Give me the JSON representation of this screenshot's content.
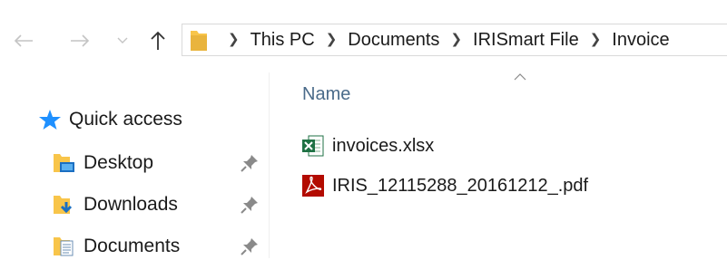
{
  "nav": {
    "back_icon": "arrow-left-icon",
    "forward_icon": "arrow-right-icon",
    "recent_icon": "chevron-down-icon",
    "up_icon": "arrow-up-icon"
  },
  "address_bar": {
    "root_icon": "folder-icon",
    "breadcrumbs": [
      "This PC",
      "Documents",
      "IRISmart File",
      "Invoice"
    ]
  },
  "sidebar": {
    "items": [
      {
        "label": "Quick access",
        "icon": "star-icon"
      },
      {
        "label": "Desktop",
        "icon": "desktop-folder-icon",
        "pinned": true
      },
      {
        "label": "Downloads",
        "icon": "downloads-folder-icon",
        "pinned": true
      },
      {
        "label": "Documents",
        "icon": "documents-folder-icon",
        "pinned": true
      }
    ]
  },
  "file_list": {
    "column_header": "Name",
    "sort_icon": "caret-up-icon",
    "files": [
      {
        "name": "invoices.xlsx",
        "icon": "excel-file-icon"
      },
      {
        "name": "IRIS_12115288_20161212_.pdf",
        "icon": "pdf-file-icon"
      }
    ]
  },
  "colors": {
    "address_border": "#d9d9d9",
    "column_header": "#4a6b8a",
    "quick_access_star": "#1e90ff",
    "folder_yellow": "#f8c54a",
    "excel_green": "#1f7244",
    "pdf_red": "#b30b00"
  }
}
